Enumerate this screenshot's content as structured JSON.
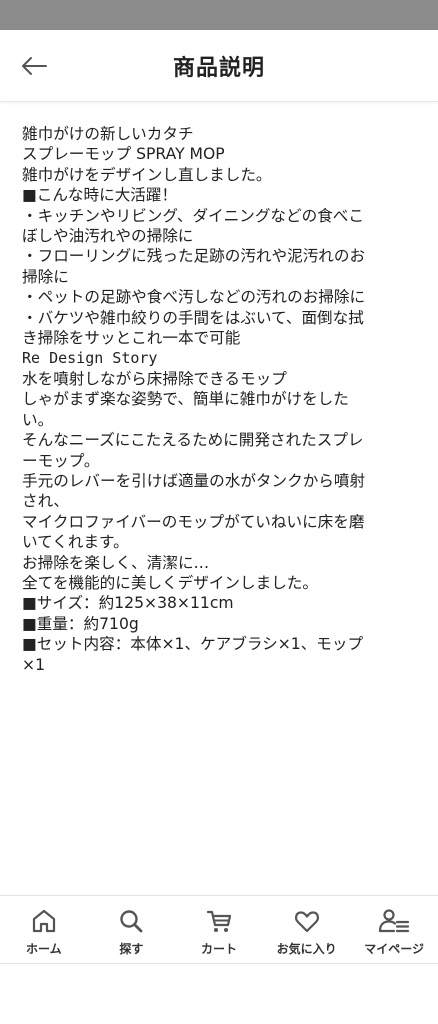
{
  "header": {
    "title": "商品説明",
    "back_icon": "arrow-left-icon"
  },
  "description": {
    "lines": [
      "雑巾がけの新しいカタチ",
      "スプレーモップ SPRAY MOP",
      "雑巾がけをデザインし直しました。",
      "■こんな時に大活躍！",
      "・キッチンやリビング、ダイニングなどの食べこ",
      "ぼしや油汚れやの掃除に",
      "・フローリングに残った足跡の汚れや泥汚れのお",
      "掃除に",
      "・ペットの足跡や食べ汚しなどの汚れのお掃除に",
      "・バケツや雑巾絞りの手間をはぶいて、面倒な拭",
      "き掃除をサッとこれ一本で可能",
      "Re Design Story",
      "水を噴射しながら床掃除できるモップ",
      "しゃがまず楽な姿勢で、簡単に雑巾がけをした",
      "い。",
      "そんなニーズにこたえるために開発されたスプレ",
      "ーモップ。",
      "手元のレバーを引けば適量の水がタンクから噴射",
      "され、",
      "マイクロファイバーのモップがていねいに床を磨",
      "いてくれます。",
      "お掃除を楽しく、清潔に…",
      "全てを機能的に美しくデザインしました。",
      "■サイズ：約125×38×11cm",
      "■重量：約710g",
      "■セット内容：本体×1、ケアブラシ×1、モップ",
      "×1"
    ]
  },
  "tabbar": {
    "items": [
      {
        "label": "ホーム",
        "icon": "home-icon"
      },
      {
        "label": "探す",
        "icon": "search-icon"
      },
      {
        "label": "カート",
        "icon": "cart-icon"
      },
      {
        "label": "お気に入り",
        "icon": "heart-icon"
      },
      {
        "label": "マイページ",
        "icon": "user-list-icon"
      }
    ]
  }
}
